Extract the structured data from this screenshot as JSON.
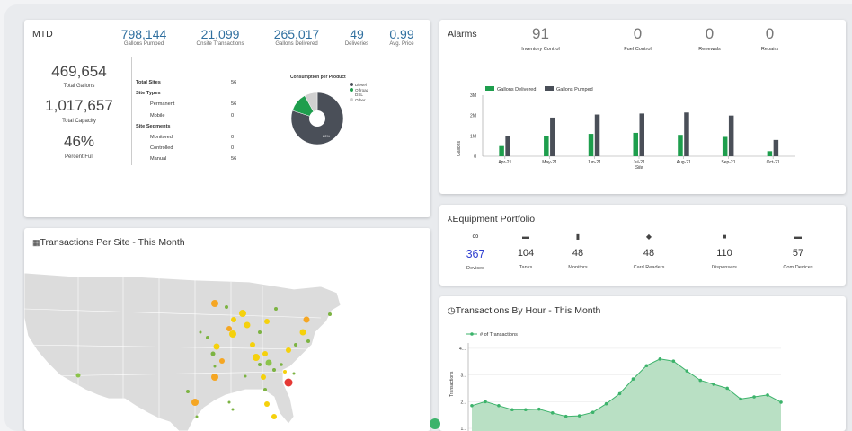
{
  "mtd": {
    "title": "MTD",
    "kpis": [
      {
        "value": "798,144",
        "label": "Gallons Pumped"
      },
      {
        "value": "21,099",
        "label": "Onsite Transactions"
      },
      {
        "value": "265,017",
        "label": "Gallons Delivered"
      },
      {
        "value": "49",
        "label": "Deliveries"
      },
      {
        "value": "0.99",
        "label": "Avg. Price"
      }
    ],
    "totals": [
      {
        "value": "469,654",
        "label": "Total Gallons"
      },
      {
        "value": "1,017,657",
        "label": "Total Capacity"
      },
      {
        "value": "46%",
        "label": "Percent Full"
      }
    ],
    "sites": [
      {
        "label": "Total Sites",
        "value": "56",
        "bold": true
      },
      {
        "label": "Site Types",
        "value": "",
        "bold": true
      },
      {
        "label": "Permanent",
        "value": "56",
        "bold": false
      },
      {
        "label": "Mobile",
        "value": "0",
        "bold": false
      },
      {
        "label": "Site Segments",
        "value": "",
        "bold": true
      },
      {
        "label": "Monitored",
        "value": "0",
        "bold": false
      },
      {
        "label": "Controlled",
        "value": "0",
        "bold": false
      },
      {
        "label": "Manual",
        "value": "56",
        "bold": false
      }
    ],
    "consumption": {
      "title": "Consumption per Product",
      "slice_label": "80%",
      "legend": [
        "Diesel",
        "Offroad",
        "DSL",
        "Other"
      ],
      "colors": {
        "diesel": "#4a4f58",
        "offroad": "#1e9e4d",
        "other": "#d0d0d0"
      },
      "slices": [
        {
          "name": "Diesel",
          "percent": 80,
          "color": "#4a4f58"
        },
        {
          "name": "Offroad DSL",
          "percent": 12,
          "color": "#1e9e4d"
        },
        {
          "name": "Other",
          "percent": 8,
          "color": "#d0d0d0"
        }
      ]
    }
  },
  "alarms": {
    "title": "Alarms",
    "items": [
      {
        "value": "91",
        "label": "Inventory Control"
      },
      {
        "value": "0",
        "label": "Fuel Control"
      },
      {
        "value": "0",
        "label": "Renewals"
      },
      {
        "value": "0",
        "label": "Repairs"
      }
    ]
  },
  "chart_data": [
    {
      "type": "bar",
      "title": "",
      "xlabel": "Site",
      "ylabel": "Gallons",
      "categories": [
        "Apr-21",
        "May-21",
        "Jun-21",
        "Jul-21",
        "Aug-21",
        "Sep-21",
        "Oct-21"
      ],
      "y_ticks": [
        "0",
        "1M",
        "2M",
        "3M"
      ],
      "ylim": [
        0,
        3000000
      ],
      "legend_position": "top",
      "series": [
        {
          "name": "Gallons Delivered",
          "color": "#1e9e4d",
          "values": [
            500000,
            1000000,
            1100000,
            1150000,
            1050000,
            950000,
            250000
          ]
        },
        {
          "name": "Gallons Pumped",
          "color": "#4a4f58",
          "values": [
            1000000,
            1900000,
            2050000,
            2100000,
            2150000,
            2000000,
            800000
          ]
        }
      ]
    },
    {
      "type": "area",
      "title": "",
      "xlabel": "",
      "ylabel": "Transactions",
      "y_ticks": [
        "1..",
        "2..",
        "3..",
        "4..."
      ],
      "ylim": [
        0.9,
        4.2
      ],
      "legend_position": "top-left",
      "series": [
        {
          "name": "# of Transactions",
          "color": "#3cb36b",
          "values": [
            1.85,
            2.0,
            1.85,
            1.7,
            1.7,
            1.72,
            1.58,
            1.45,
            1.47,
            1.6,
            1.92,
            2.3,
            2.85,
            3.35,
            3.6,
            3.52,
            3.15,
            2.8,
            2.65,
            2.5,
            2.1,
            2.18,
            2.25,
            1.98
          ]
        }
      ]
    }
  ],
  "transactions_map": {
    "title": "Transactions Per Site - This Month"
  },
  "equipment": {
    "title": "Equipment Portfolio",
    "items": [
      {
        "icon": "infinity-icon",
        "glyph": "∞",
        "value": "367",
        "label": "Devices",
        "highlight": true
      },
      {
        "icon": "tank-icon",
        "glyph": "▬",
        "value": "104",
        "label": "Tanks",
        "highlight": false
      },
      {
        "icon": "monitor-icon",
        "glyph": "▮",
        "value": "48",
        "label": "Monitors",
        "highlight": false
      },
      {
        "icon": "shield-icon",
        "glyph": "◆",
        "value": "48",
        "label": "Card Readers",
        "highlight": false
      },
      {
        "icon": "fuel-pump-icon",
        "glyph": "■",
        "value": "110",
        "label": "Dispensers",
        "highlight": false
      },
      {
        "icon": "com-device-icon",
        "glyph": "▬",
        "value": "57",
        "label": "Com Devices",
        "highlight": false
      }
    ]
  },
  "hourly": {
    "title": "Transactions By Hour - This Month"
  }
}
